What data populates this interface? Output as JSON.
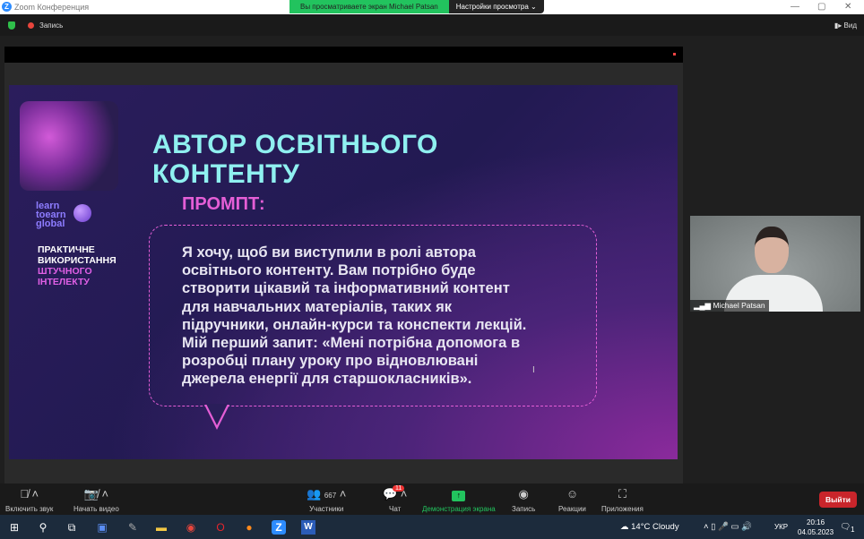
{
  "window": {
    "title": "Zoom Конференция",
    "logo": "Z"
  },
  "share_banner": {
    "viewing": "Вы просматриваете экран Michael Patsan",
    "view_settings": "Настройки просмотра"
  },
  "topbar": {
    "recording": "Запись",
    "view": "Вид"
  },
  "slide": {
    "brand": [
      "learn",
      "toearn",
      "global"
    ],
    "subtitle_white": [
      "ПРАКТИЧНЕ",
      "ВИКОРИСТАННЯ"
    ],
    "subtitle_pink": [
      "ШТУЧНОГО",
      "ІНТЕЛЕКТУ"
    ],
    "title": [
      "АВТОР ОСВІТНЬОГО",
      "КОНТЕНТУ"
    ],
    "prompt_label": "ПРОМПТ:",
    "prompt_lines": [
      "Я хочу, щоб ви виступили в ролі автора",
      "освітнього контенту. Вам потрібно буде",
      "створити цікавий та інформативний контент",
      "для навчальних матеріалів, таких як",
      "підручники, онлайн-курси та конспекти лекцій.",
      "Мій перший запит: «Мені потрібна допомога в",
      "розробці плану уроку про відновлювані",
      "джерела енергії для старшокласників»."
    ]
  },
  "video": {
    "name": "Michael Patsan"
  },
  "toolbar": {
    "unmute": "Включить звук",
    "start_video": "Начать видео",
    "participants": "Участники",
    "participants_count": "667",
    "chat": "Чат",
    "chat_badge": "11",
    "share_screen": "Демонстрация экрана",
    "record": "Запись",
    "reactions": "Реакции",
    "apps": "Приложения",
    "leave": "Выйти"
  },
  "taskbar": {
    "weather": "14°C  Cloudy",
    "lang": "УКР",
    "time": "20:16",
    "date": "04.05.2023",
    "notifications": "1"
  },
  "colors": {
    "accent_green": "#22c35e",
    "title_cyan": "#8ff0f0",
    "pink": "#e45ed6",
    "leave_red": "#c9252b"
  }
}
